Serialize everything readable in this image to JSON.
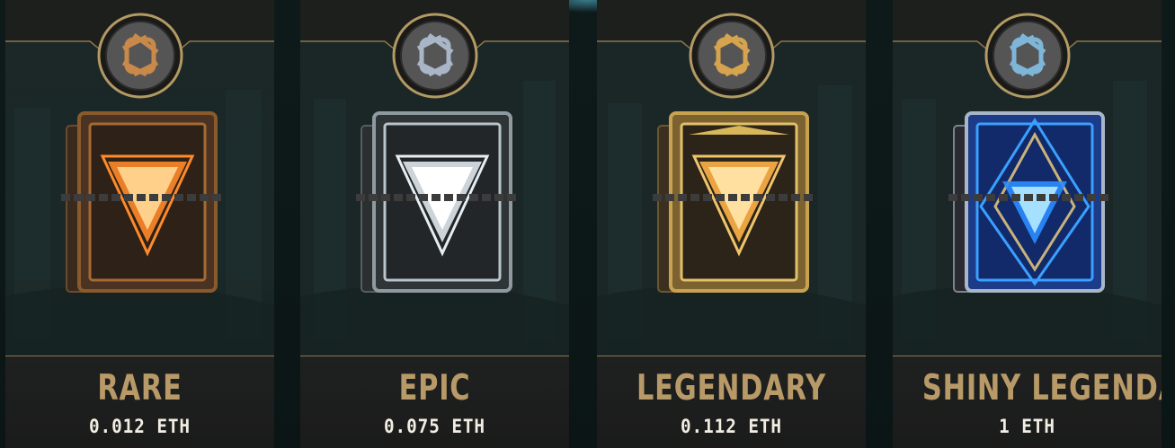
{
  "packs": [
    {
      "id": "rare",
      "name": "RARE",
      "price": "0.012 ETH",
      "emblem_icon": "knot-emblem-bronze",
      "book_icon": "card-pack-book-rare",
      "colors": {
        "accent": "#ff8a2a",
        "metal": "#8a5a2c",
        "emblem": "#c9894a"
      }
    },
    {
      "id": "epic",
      "name": "EPIC",
      "price": "0.075 ETH",
      "emblem_icon": "knot-emblem-silver",
      "book_icon": "card-pack-book-epic",
      "colors": {
        "accent": "#f4f7f8",
        "metal": "#6e7a80",
        "emblem": "#a9b6c7"
      }
    },
    {
      "id": "legendary",
      "name": "LEGENDARY",
      "price": "0.112 ETH",
      "emblem_icon": "knot-emblem-gold",
      "book_icon": "card-pack-book-legendary",
      "colors": {
        "accent": "#ffb347",
        "metal": "#b08a3a",
        "emblem": "#d6a44e"
      }
    },
    {
      "id": "shiny-legendary",
      "name": "SHINY LEGENDARY",
      "price": "1 ETH",
      "emblem_icon": "knot-emblem-blue",
      "book_icon": "card-pack-book-shiny-legendary",
      "colors": {
        "accent": "#3aa0ff",
        "metal": "#1f48a8",
        "emblem": "#7fb6d8"
      }
    }
  ]
}
